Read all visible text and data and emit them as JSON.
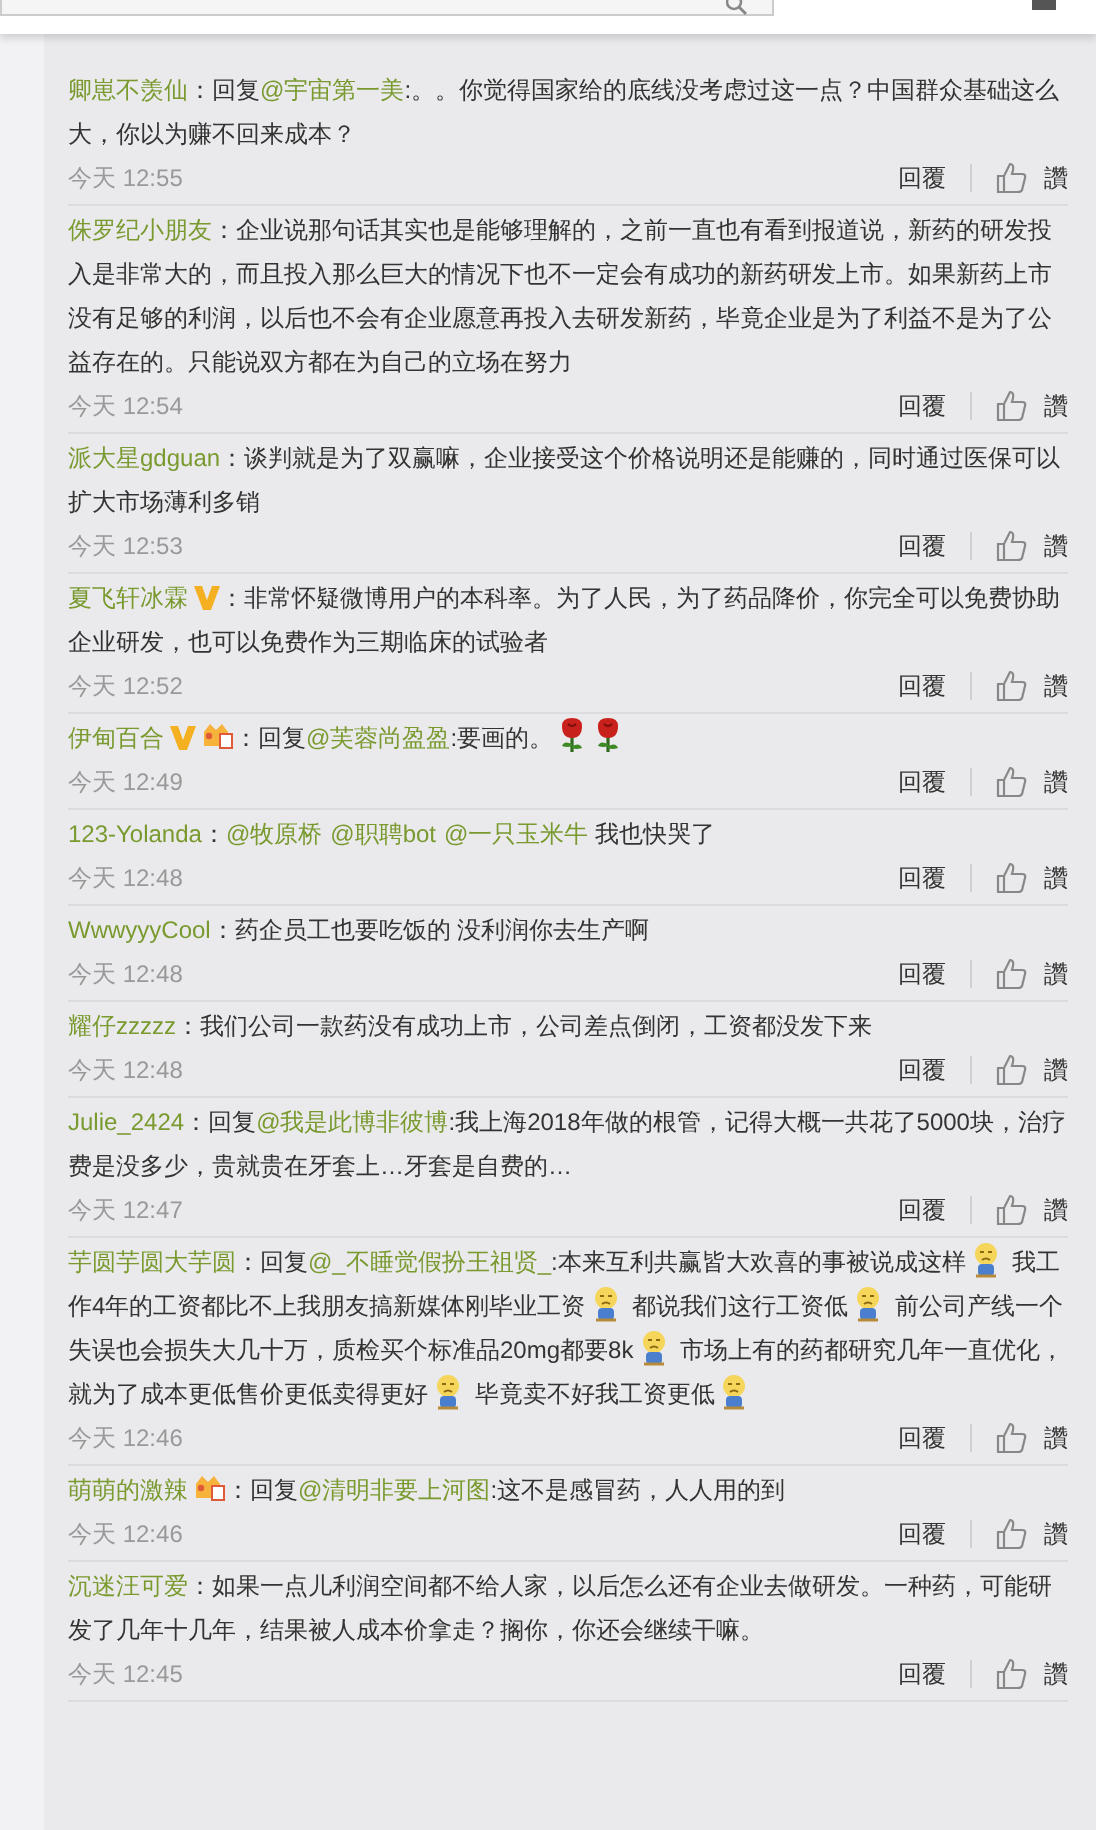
{
  "comments": [
    {
      "user": "卿崽不羡仙",
      "content": [
        {
          "kind": "text",
          "text": "：回复"
        },
        {
          "kind": "mention",
          "text": "@宇宙第一美"
        },
        {
          "kind": "text",
          "text": ":。。你觉得国家给的底线没考虑过这一点？中国群众基础这么大，你以为赚不回来成本？"
        }
      ],
      "time": "今天 12:55",
      "reply": "回覆",
      "like": "讚"
    },
    {
      "user": "侏罗纪小朋友",
      "content": [
        {
          "kind": "text",
          "text": "：企业说那句话其实也是能够理解的，之前一直也有看到报道说，新药的研发投入是非常大的，而且投入那么巨大的情况下也不一定会有成功的新药研发上市。如果新药上市没有足够的利润，以后也不会有企业愿意再投入去研发新药，毕竟企业是为了利益不是为了公益存在的。只能说双方都在为自己的立场在努力"
        }
      ],
      "time": "今天 12:54",
      "reply": "回覆",
      "like": "讚"
    },
    {
      "user": "派大星gdguan",
      "content": [
        {
          "kind": "text",
          "text": "：谈判就是为了双赢嘛，企业接受这个价格说明还是能赚的，同时通过医保可以扩大市场薄利多销"
        }
      ],
      "time": "今天 12:53",
      "reply": "回覆",
      "like": "讚"
    },
    {
      "user": "夏飞轩冰霖",
      "badges": [
        {
          "kind": "verified"
        }
      ],
      "content": [
        {
          "kind": "text",
          "text": "：非常怀疑微博用户的本科率。为了人民，为了药品降价，你完全可以免费协助企业研发，也可以免费作为三期临床的试验者"
        }
      ],
      "time": "今天 12:52",
      "reply": "回覆",
      "like": "讚"
    },
    {
      "user": "伊甸百合",
      "badges": [
        {
          "kind": "verified"
        },
        {
          "kind": "member"
        }
      ],
      "content": [
        {
          "kind": "text",
          "text": "：回复"
        },
        {
          "kind": "mention",
          "text": "@芙蓉尚盈盈"
        },
        {
          "kind": "text",
          "text": ":要画的。"
        },
        {
          "kind": "rose"
        },
        {
          "kind": "rose"
        }
      ],
      "time": "今天 12:49",
      "reply": "回覆",
      "like": "讚"
    },
    {
      "user": "123-Yolanda",
      "content": [
        {
          "kind": "text",
          "text": "："
        },
        {
          "kind": "mention",
          "text": "@牧原桥"
        },
        {
          "kind": "mention",
          "text": "@职聘bot"
        },
        {
          "kind": "mention",
          "text": "@一只玉米牛"
        },
        {
          "kind": "text",
          "text": " 我也快哭了"
        }
      ],
      "time": "今天 12:48",
      "reply": "回覆",
      "like": "讚"
    },
    {
      "user": "WwwyyyCool",
      "content": [
        {
          "kind": "text",
          "text": "：药企员工也要吃饭的 没利润你去生产啊"
        }
      ],
      "time": "今天 12:48",
      "reply": "回覆",
      "like": "讚"
    },
    {
      "user": "耀仔zzzzz",
      "content": [
        {
          "kind": "text",
          "text": "：我们公司一款药没有成功上市，公司差点倒闭，工资都没发下来"
        }
      ],
      "time": "今天 12:48",
      "reply": "回覆",
      "like": "讚"
    },
    {
      "user": "Julie_2424",
      "content": [
        {
          "kind": "text",
          "text": "：回复"
        },
        {
          "kind": "mention",
          "text": "@我是此博非彼博"
        },
        {
          "kind": "text",
          "text": ":我上海2018年做的根管，记得大概一共花了5000块，治疗费是没多少，贵就贵在牙套上…牙套是自费的…"
        }
      ],
      "time": "今天 12:47",
      "reply": "回覆",
      "like": "讚"
    },
    {
      "user": "芋圆芋圆大芋圆",
      "content": [
        {
          "kind": "text",
          "text": "：回复"
        },
        {
          "kind": "mention",
          "text": "@_不睡觉假扮王祖贤_"
        },
        {
          "kind": "text",
          "text": ":本来互利共赢皆大欢喜的事被说成这样"
        },
        {
          "kind": "sadface"
        },
        {
          "kind": "text",
          "text": " 我工作4年的工资都比不上我朋友搞新媒体刚毕业工资"
        },
        {
          "kind": "sadface"
        },
        {
          "kind": "text",
          "text": " 都说我们这行工资低"
        },
        {
          "kind": "sadface"
        },
        {
          "kind": "text",
          "text": " 前公司产线一个失误也会损失大几十万，质检买个标准品20mg都要8k"
        },
        {
          "kind": "sadface"
        },
        {
          "kind": "text",
          "text": " 市场上有的药都研究几年一直优化，就为了成本更低售价更低卖得更好"
        },
        {
          "kind": "sadface"
        },
        {
          "kind": "text",
          "text": " 毕竟卖不好我工资更低"
        },
        {
          "kind": "sadface"
        }
      ],
      "time": "今天 12:46",
      "reply": "回覆",
      "like": "讚"
    },
    {
      "user": "萌萌的激辣",
      "badges": [
        {
          "kind": "member"
        }
      ],
      "content": [
        {
          "kind": "text",
          "text": "：回复"
        },
        {
          "kind": "mention",
          "text": "@清明非要上河图"
        },
        {
          "kind": "text",
          "text": ":这不是感冒药，人人用的到"
        }
      ],
      "time": "今天 12:46",
      "reply": "回覆",
      "like": "讚"
    },
    {
      "user": "沉迷汪可爱",
      "content": [
        {
          "kind": "text",
          "text": "：如果一点儿利润空间都不给人家，以后怎么还有企业去做研发。一种药，可能研发了几年十几年，结果被人成本价拿走？搁你，你还会继续干嘛。"
        }
      ],
      "time": "今天 12:45",
      "reply": "回覆",
      "like": "讚"
    }
  ]
}
